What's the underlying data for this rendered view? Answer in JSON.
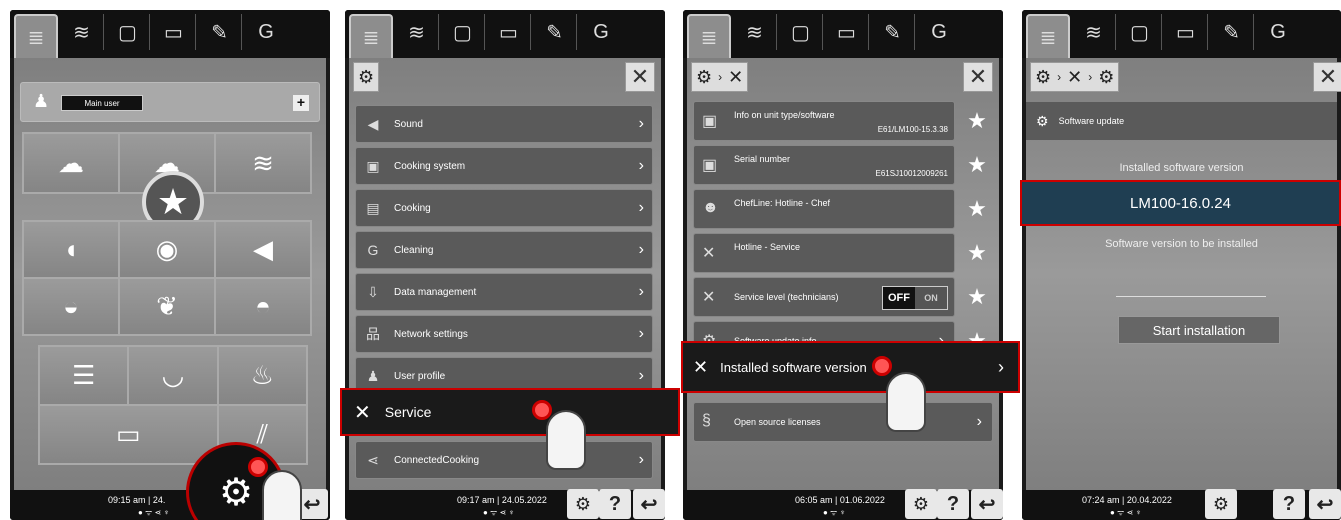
{
  "screens": [
    {
      "user_label": "Main user",
      "time": "09:15 am | 24.",
      "status_dots": "● ᯤ ⋖ ♆"
    },
    {
      "menu": [
        "Sound",
        "Cooking system",
        "Cooking",
        "Cleaning",
        "Data management",
        "Network settings",
        "User profile",
        "Service",
        "ConnectedCooking"
      ],
      "time": "09:17 am | 24.05.2022",
      "status_dots": "● ᯤ ⋖ ♆"
    },
    {
      "rows": [
        {
          "label": "Info on unit type/software",
          "value": "E61/LM100-15.3.38"
        },
        {
          "label": "Serial number",
          "value": "E61SJ10012009261"
        },
        {
          "label": "ChefLine: Hotline - Chef",
          "value": ""
        },
        {
          "label": "Hotline - Service",
          "value": ""
        },
        {
          "label": "Service level (technicians)",
          "value": ""
        },
        {
          "label": "Software update info",
          "value": ""
        },
        {
          "label": "Installed software version",
          "value": ""
        },
        {
          "label": "Open source licenses",
          "value": ""
        }
      ],
      "toggle_off": "OFF",
      "toggle_on": "ON",
      "time": "06:05 am | 01.06.2022",
      "status_dots": "● ᯤ ♆"
    },
    {
      "section_title": "Software update",
      "installed_label": "Installed software version",
      "installed_value": "LM100-16.0.24",
      "to_install_label": "Software version to be installed",
      "start_button": "Start installation",
      "time": "07:24 am | 20.04.2022",
      "status_dots": "● ᯤ ⋖ ♆"
    }
  ],
  "icons": {
    "help": "?",
    "back": "↩"
  },
  "colors": {
    "highlight_border": "#cc0000",
    "version_bar": "#1f3e52"
  }
}
